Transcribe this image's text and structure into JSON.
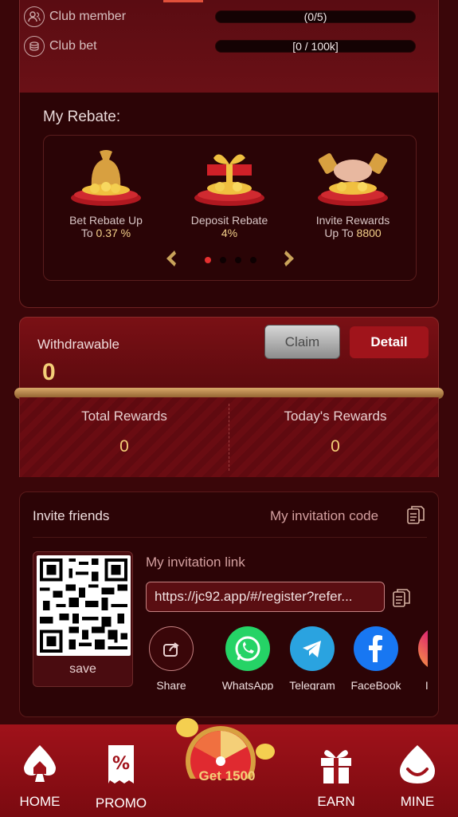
{
  "club": {
    "member_label": "Club member",
    "member_value": "(0/5)",
    "bet_label": "Club bet",
    "bet_value": "[0 / 100k]"
  },
  "rebate": {
    "title": "My Rebate:",
    "items": [
      {
        "line1": "Bet Rebate Up",
        "line2_prefix": "To ",
        "line2_value": "0.37 %"
      },
      {
        "line1": "Deposit Rebate",
        "line2_prefix": "",
        "line2_value": "4%"
      },
      {
        "line1": "Invite Rewards",
        "line2_prefix": "Up To ",
        "line2_value": "8800"
      }
    ],
    "page_count": 4,
    "active_page": 1
  },
  "withdraw": {
    "label": "Withdrawable",
    "value": "0",
    "claim_label": "Claim",
    "detail_label": "Detail"
  },
  "rewards": {
    "total_label": "Total Rewards",
    "total_value": "0",
    "today_label": "Today's Rewards",
    "today_value": "0"
  },
  "invite": {
    "title": "Invite friends",
    "code_label": "My invitation code",
    "link_label": "My invitation link",
    "link_value": "https://jc92.app/#/register?refer...",
    "save_label": "save",
    "share": [
      {
        "label": "Share",
        "icon": "share-icon"
      },
      {
        "label": "WhatsApp",
        "icon": "whatsapp-icon"
      },
      {
        "label": "Telegram",
        "icon": "telegram-icon"
      },
      {
        "label": "FaceBook",
        "icon": "facebook-icon"
      },
      {
        "label": "Instag",
        "icon": "instagram-icon"
      }
    ]
  },
  "nav": {
    "home": "HOME",
    "promo": "PROMO",
    "center": "Get 1500",
    "earn": "EARN",
    "mine": "MINE"
  },
  "colors": {
    "background": "#3a0609",
    "accent_red": "#a0141b",
    "gold": "#f4cf78",
    "whatsapp": "#25d366",
    "telegram": "#2aa3e0",
    "facebook": "#1877f2"
  }
}
